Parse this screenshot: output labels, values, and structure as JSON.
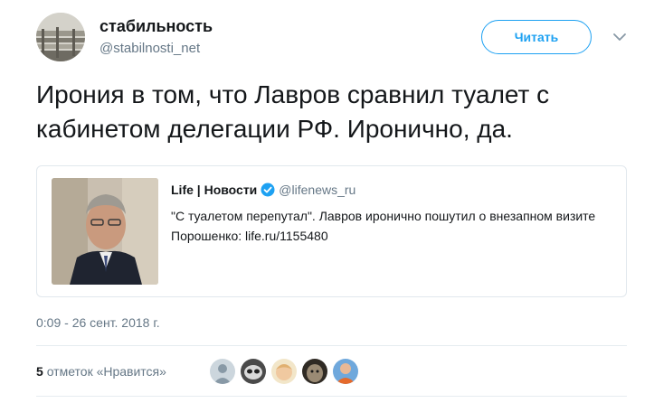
{
  "author": {
    "display_name": "стабильность",
    "screen_name": "@stabilnosti_net"
  },
  "follow_button_label": "Читать",
  "tweet_text": "Ирония в том, что Лавров сравнил туалет с кабинетом делегации РФ. Иронично, да.",
  "quoted_tweet": {
    "name": "Life | Новости",
    "handle": "@lifenews_ru",
    "text": "\"С туалетом перепутал\". Лавров иронично пошутил о внезапном визите Порошенко: life.ru/1155480"
  },
  "timestamp": "0:09 - 26 сент. 2018 г.",
  "likes": {
    "count": "5",
    "label": "отметок «Нравится»"
  },
  "icons": {
    "caret": "chevron-down-icon",
    "verified": "verified-badge-icon"
  },
  "colors": {
    "accent": "#1da1f2",
    "secondary_text": "#657786",
    "border": "#e1e8ed"
  }
}
